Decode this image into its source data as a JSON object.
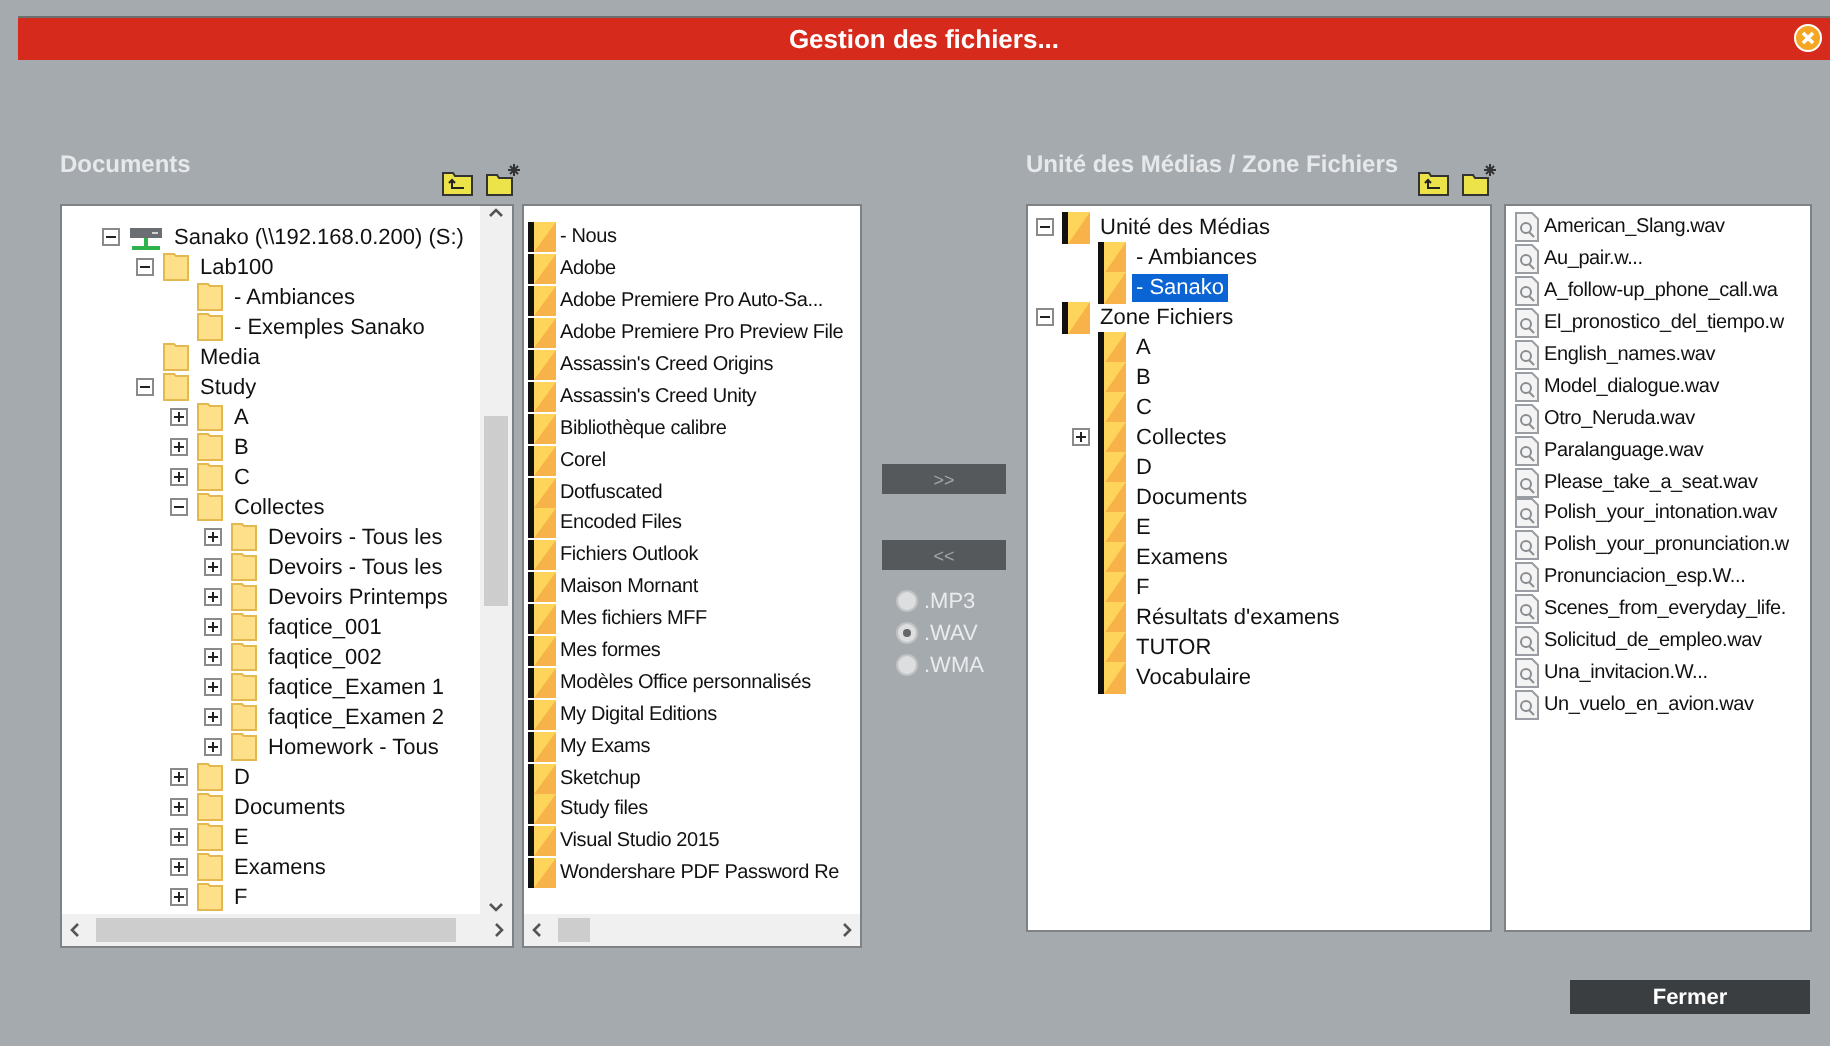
{
  "window": {
    "title": "Gestion des fichiers..."
  },
  "documents": {
    "title": "Documents",
    "tree": [
      {
        "label": "Sanako (\\\\192.168.0.200) (S:)",
        "kind": "drive",
        "expanded": true,
        "children": [
          {
            "label": "Lab100",
            "kind": "folder",
            "expanded": true,
            "children": [
              {
                "label": "- Ambiances",
                "kind": "folder"
              },
              {
                "label": "- Exemples Sanako",
                "kind": "folder"
              }
            ]
          },
          {
            "label": "Media",
            "kind": "folder"
          },
          {
            "label": "Study",
            "kind": "folder",
            "expanded": true,
            "children": [
              {
                "label": "A",
                "kind": "folder",
                "expanded": false
              },
              {
                "label": "B",
                "kind": "folder",
                "expanded": false
              },
              {
                "label": "C",
                "kind": "folder",
                "expanded": false
              },
              {
                "label": "Collectes",
                "kind": "folder",
                "expanded": true,
                "children": [
                  {
                    "label": "Devoirs - Tous les",
                    "kind": "folder",
                    "expanded": false
                  },
                  {
                    "label": "Devoirs - Tous les",
                    "kind": "folder",
                    "expanded": false
                  },
                  {
                    "label": "Devoirs Printemps",
                    "kind": "folder",
                    "expanded": false
                  },
                  {
                    "label": "faqtice_001",
                    "kind": "folder",
                    "expanded": false
                  },
                  {
                    "label": "faqtice_002",
                    "kind": "folder",
                    "expanded": false
                  },
                  {
                    "label": "faqtice_Examen 1",
                    "kind": "folder",
                    "expanded": false
                  },
                  {
                    "label": "faqtice_Examen 2",
                    "kind": "folder",
                    "expanded": false
                  },
                  {
                    "label": "Homework - Tous",
                    "kind": "folder",
                    "expanded": false
                  }
                ]
              },
              {
                "label": "D",
                "kind": "folder",
                "expanded": false
              },
              {
                "label": "Documents",
                "kind": "folder",
                "expanded": false
              },
              {
                "label": "E",
                "kind": "folder",
                "expanded": false
              },
              {
                "label": "Examens",
                "kind": "folder",
                "expanded": false
              },
              {
                "label": "F",
                "kind": "folder",
                "expanded": false
              }
            ]
          }
        ]
      }
    ],
    "folders": [
      "- Nous",
      "Adobe",
      "Adobe Premiere Pro Auto-Sa...",
      "Adobe Premiere Pro Preview File",
      "Assassin's Creed Origins",
      "Assassin's Creed Unity",
      "Bibliothèque calibre",
      "Corel",
      "Dotfuscated",
      "Encoded Files",
      "Fichiers Outlook",
      "Maison Mornant",
      "Mes fichiers MFF",
      "Mes formes",
      "Modèles Office personnalisés",
      "My Digital Editions",
      "My Exams",
      "Sketchup",
      "Study files",
      "Visual Studio 2015",
      "Wondershare PDF Password Re"
    ]
  },
  "transfer": {
    "buttons": [
      ">>",
      "<<"
    ],
    "formats": [
      {
        "label": ".MP3",
        "selected": false
      },
      {
        "label": ".WAV",
        "selected": true
      },
      {
        "label": ".WMA",
        "selected": false
      }
    ]
  },
  "media": {
    "title": "Unité des Médias / Zone Fichiers",
    "tree": [
      {
        "label": "Unité des Médias",
        "kind": "folder",
        "expanded": true,
        "selected": false,
        "children": [
          {
            "label": "- Ambiances",
            "kind": "folder",
            "selected": false
          },
          {
            "label": "- Sanako",
            "kind": "folder",
            "selected": true
          }
        ]
      },
      {
        "label": "Zone Fichiers",
        "kind": "folder",
        "expanded": true,
        "selected": false,
        "children": [
          {
            "label": "A",
            "kind": "folder",
            "selected": false
          },
          {
            "label": "B",
            "kind": "folder",
            "selected": false
          },
          {
            "label": "C",
            "kind": "folder",
            "selected": false
          },
          {
            "label": "Collectes",
            "kind": "folder",
            "expanded": false,
            "selected": false
          },
          {
            "label": "D",
            "kind": "folder",
            "selected": false
          },
          {
            "label": "Documents",
            "kind": "folder",
            "selected": false
          },
          {
            "label": "E",
            "kind": "folder",
            "selected": false
          },
          {
            "label": "Examens",
            "kind": "folder",
            "selected": false
          },
          {
            "label": "F",
            "kind": "folder",
            "selected": false
          },
          {
            "label": "Résultats d'examens",
            "kind": "folder",
            "selected": false
          },
          {
            "label": "TUTOR",
            "kind": "folder",
            "selected": false
          },
          {
            "label": "Vocabulaire",
            "kind": "folder",
            "selected": false
          }
        ]
      }
    ],
    "files": [
      "American_Slang.wav",
      "Au_pair.w...",
      "A_follow-up_phone_call.wa",
      "El_pronostico_del_tiempo.w",
      "English_names.wav",
      "Model_dialogue.wav",
      "Otro_Neruda.wav",
      "Paralanguage.wav",
      "Please_take_a_seat.wav",
      "Polish_your_intonation.wav",
      "Polish_your_pronunciation.w",
      "Pronunciacion_esp.W...",
      "Scenes_from_everyday_life.",
      "Solicitud_de_empleo.wav",
      "Una_invitacion.W...",
      "Un_vuelo_en_avion.wav"
    ]
  },
  "close_button": "Fermer"
}
